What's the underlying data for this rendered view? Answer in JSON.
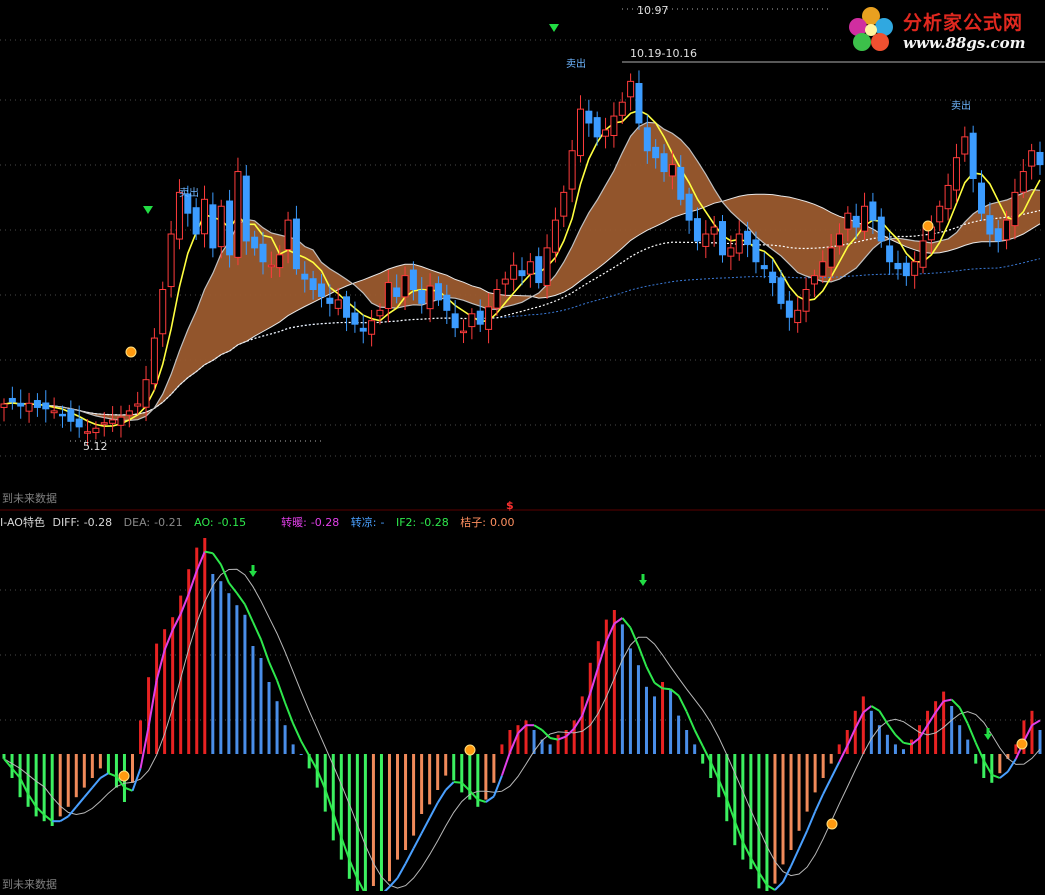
{
  "logo": {
    "title": "分析家公式网",
    "url": "www.88gs.com",
    "icon": "flower-logo-icon"
  },
  "price_panel": {
    "high_label": "10.97",
    "range_label": "10.19-10.16",
    "low_label": "5.12",
    "bottom_note": "到未来数据",
    "marker_dollar": "$",
    "signal_sell_label": "卖出"
  },
  "indicator_panel": {
    "title": "I-AO特色",
    "diff": {
      "label": "DIFF:",
      "value": "-0.28",
      "color": "#d8d8d8"
    },
    "dea": {
      "label": "DEA:",
      "value": "-0.21",
      "color": "#8a8a8a"
    },
    "ao": {
      "label": "AO:",
      "value": "-0.15",
      "color": "#2ee84c"
    },
    "zhuannuan": {
      "label": "转暖:",
      "value": "-0.28",
      "color": "#e040e8"
    },
    "zhuanliang": {
      "label": "转凉:",
      "value": "-",
      "color": "#4aa0ff"
    },
    "if2": {
      "label": "IF2:",
      "value": "-0.28",
      "color": "#2ee84c"
    },
    "juzi": {
      "label": "桔子:",
      "value": "0.00",
      "color": "#ff9060"
    },
    "bottom_note": "到未来数据"
  },
  "colors": {
    "up": "#ff3c3c",
    "down": "#3c9cff",
    "band_fill": "#9a5a2e",
    "band_green": "#1f7a2a",
    "hist_red": "#e82222",
    "hist_blue": "#4a8ee8",
    "hist_green": "#3cf060",
    "hist_orange": "#f08a5a",
    "grid": "#4a4a4a"
  },
  "chart_data": [
    {
      "type": "candlestick",
      "title": "",
      "annotations": [
        "10.97",
        "10.19-10.16",
        "5.12",
        "卖出"
      ],
      "ohlc_close": [
        5.55,
        5.58,
        5.52,
        5.56,
        5.5,
        5.48,
        5.45,
        5.4,
        5.3,
        5.22,
        5.15,
        5.2,
        5.28,
        5.32,
        5.36,
        5.45,
        5.55,
        5.9,
        6.5,
        7.2,
        8.0,
        8.6,
        8.3,
        8.0,
        8.5,
        7.8,
        8.4,
        7.7,
        8.9,
        7.9,
        7.8,
        7.6,
        7.55,
        7.7,
        8.2,
        7.5,
        7.35,
        7.2,
        7.1,
        7.0,
        7.05,
        6.8,
        6.7,
        6.6,
        6.75,
        6.9,
        7.3,
        7.1,
        7.4,
        7.2,
        7.0,
        7.25,
        7.05,
        6.9,
        6.65,
        6.6,
        6.85,
        6.7,
        6.95,
        7.2,
        7.35,
        7.55,
        7.4,
        7.6,
        7.3,
        7.8,
        8.2,
        8.6,
        9.2,
        9.8,
        9.6,
        9.4,
        9.5,
        9.7,
        9.9,
        10.2,
        9.6,
        9.2,
        9.1,
        8.9,
        9.0,
        8.5,
        8.2,
        7.9,
        8.0,
        8.1,
        7.7,
        7.8,
        8.0,
        7.85,
        7.6,
        7.5,
        7.3,
        7.0,
        6.8,
        6.9,
        7.2,
        7.4,
        7.6,
        7.8,
        8.0,
        8.3,
        8.1,
        8.4,
        8.2,
        7.9,
        7.6,
        7.5,
        7.4,
        7.6,
        7.9,
        8.1,
        8.4,
        8.7,
        9.1,
        9.4,
        8.8,
        8.3,
        8.0,
        7.9,
        8.2,
        8.6,
        8.9,
        9.2,
        9.0
      ],
      "ylim": [
        4.8,
        11.2
      ]
    },
    {
      "type": "bar",
      "title": "I-AO特色",
      "series": [
        {
          "name": "AO",
          "values": [
            -0.02,
            -0.1,
            -0.18,
            -0.22,
            -0.26,
            -0.28,
            -0.3,
            -0.26,
            -0.22,
            -0.18,
            -0.14,
            -0.1,
            -0.06,
            -0.08,
            -0.14,
            -0.2,
            -0.12,
            0.14,
            0.32,
            0.46,
            0.52,
            0.57,
            0.66,
            0.77,
            0.86,
            0.9,
            0.75,
            0.72,
            0.67,
            0.62,
            0.58,
            0.45,
            0.4,
            0.3,
            0.22,
            0.12,
            0.04,
            0.0,
            -0.06,
            -0.14,
            -0.24,
            -0.36,
            -0.44,
            -0.52,
            -0.6,
            -0.63,
            -0.55,
            -0.58,
            -0.53,
            -0.44,
            -0.4,
            -0.34,
            -0.25,
            -0.21,
            -0.15,
            -0.09,
            -0.11,
            -0.16,
            -0.19,
            -0.22,
            -0.19,
            -0.12,
            0.04,
            0.1,
            0.12,
            0.14,
            0.1,
            0.06,
            0.04,
            0.08,
            0.1,
            0.14,
            0.24,
            0.38,
            0.47,
            0.56,
            0.6,
            0.54,
            0.44,
            0.37,
            0.28,
            0.24,
            0.3,
            0.27,
            0.16,
            0.1,
            0.04,
            -0.04,
            -0.1,
            -0.18,
            -0.28,
            -0.38,
            -0.44,
            -0.48,
            -0.56,
            -0.6,
            -0.54,
            -0.46,
            -0.4,
            -0.32,
            -0.24,
            -0.16,
            -0.1,
            -0.04,
            0.04,
            0.1,
            0.18,
            0.24,
            0.18,
            0.12,
            0.08,
            0.04,
            0.02,
            0.06,
            0.12,
            0.18,
            0.22,
            0.26,
            0.2,
            0.12,
            0.06,
            -0.04,
            -0.1,
            -0.12,
            -0.08,
            -0.02,
            0.04,
            0.14,
            0.18,
            0.1
          ]
        }
      ]
    }
  ]
}
